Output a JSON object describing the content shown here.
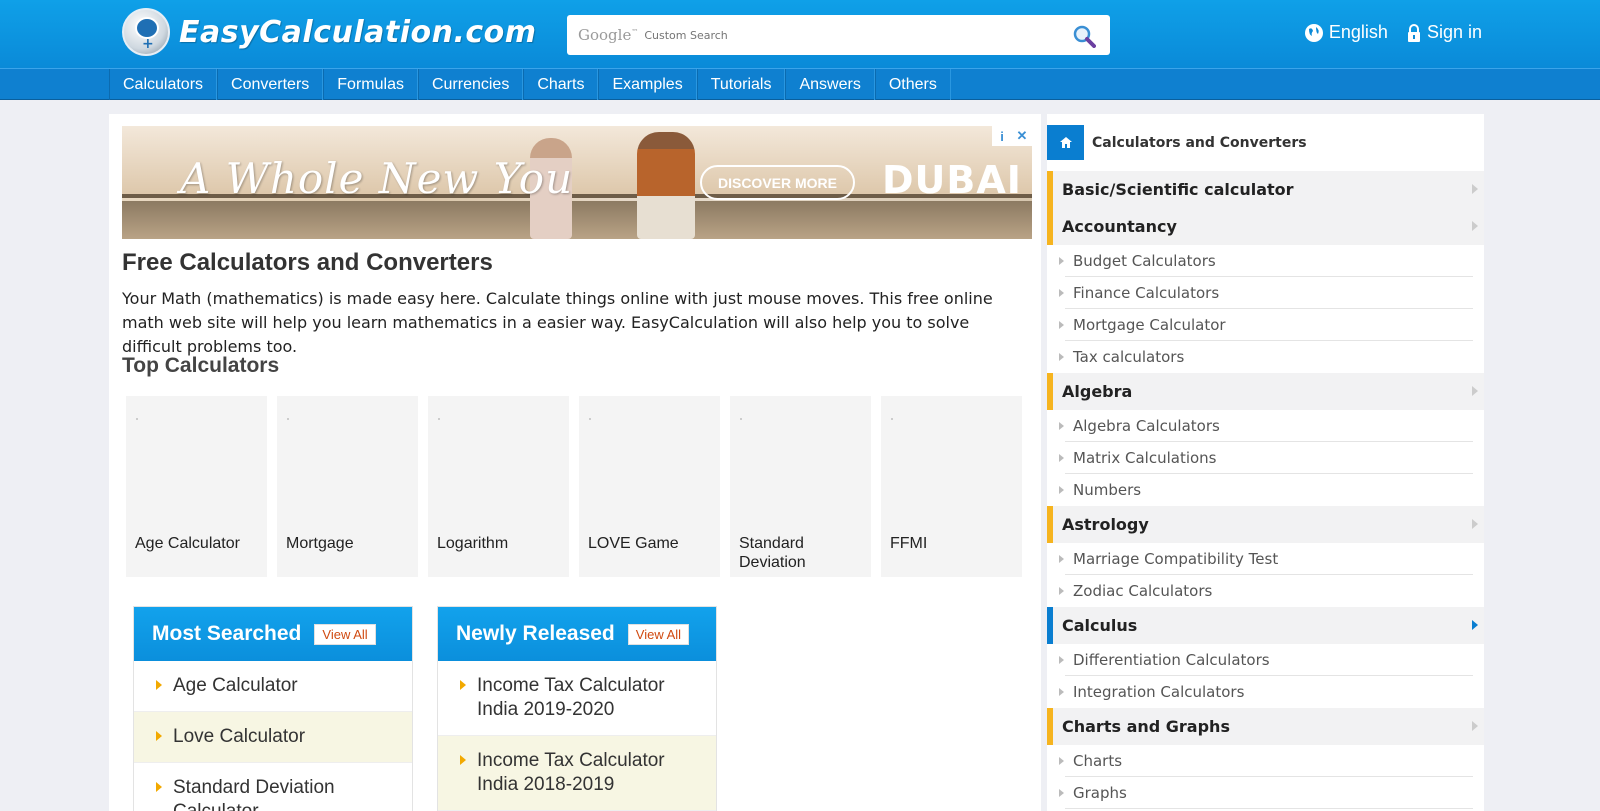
{
  "site": {
    "logo_text": "EasyCalculation.com"
  },
  "search": {
    "brand": "Google",
    "placeholder": "Custom Search"
  },
  "topright": {
    "language": "English",
    "signin": "Sign in"
  },
  "nav": [
    "Calculators",
    "Converters",
    "Formulas",
    "Currencies",
    "Charts",
    "Examples",
    "Tutorials",
    "Answers",
    "Others"
  ],
  "ad": {
    "tagline": "A Whole New You",
    "cta": "DISCOVER MORE",
    "brand": "DUBAI",
    "info": "i",
    "close": "✕"
  },
  "main": {
    "title": "Free Calculators and Converters",
    "intro": "Your Math (mathematics) is made easy here. Calculate things online with just mouse moves. This free online math web site will help you learn mathematics in a easier way. EasyCalculation will also help you to solve difficult problems too.",
    "top_title": "Top Calculators",
    "tiles": [
      "Age Calculator",
      "Mortgage",
      "Logarithm",
      "LOVE Game",
      "Standard Deviation",
      "FFMI"
    ]
  },
  "most_searched": {
    "title": "Most Searched",
    "view_all": "View All",
    "items": [
      "Age Calculator",
      "Love Calculator",
      "Standard Deviation Calculator"
    ]
  },
  "newly_released": {
    "title": "Newly Released",
    "view_all": "View All",
    "items": [
      "Income Tax Calculator India 2019-2020",
      "Income Tax Calculator India 2018-2019"
    ]
  },
  "sidebar": {
    "title": "Calculators and Converters",
    "groups": [
      {
        "label": "Basic/Scientific calculator",
        "items": []
      },
      {
        "label": "Accountancy",
        "items": [
          "Budget Calculators",
          "Finance Calculators",
          "Mortgage Calculator",
          "Tax calculators"
        ]
      },
      {
        "label": "Algebra",
        "items": [
          "Algebra Calculators",
          "Matrix Calculations",
          "Numbers"
        ]
      },
      {
        "label": "Astrology",
        "items": [
          "Marriage Compatibility Test",
          "Zodiac Calculators"
        ]
      },
      {
        "label": "Calculus",
        "items": [
          "Differentiation Calculators",
          "Integration Calculators"
        ]
      },
      {
        "label": "Charts and Graphs",
        "items": [
          "Charts",
          "Graphs"
        ]
      }
    ]
  },
  "colors": {
    "header_blue": "#0a8ad8",
    "nav_blue": "#0f80d0",
    "accent_orange": "#f6b41f",
    "active_blue": "#0a7ed0"
  }
}
